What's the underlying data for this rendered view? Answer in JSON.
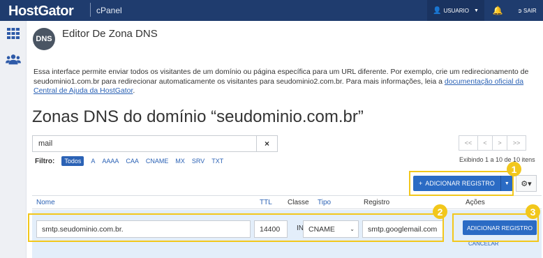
{
  "header": {
    "logo": "HostGator",
    "product": "cPanel",
    "user_label": "USUARIO",
    "logout_label": "SAIR"
  },
  "page": {
    "title": "Editor De Zona DNS",
    "icon_text": "DNS",
    "description_text": "Essa interface permite enviar todos os visitantes de um domínio ou página específica para um URL diferente. Por exemplo, crie um redirecionamento de seudominio1.com.br para redirecionar automaticamente os visitantes para seudominio2.com.br. Para mais informações, leia a ",
    "description_link": "documentação oficial da Central de Ajuda da HostGator",
    "description_end": ".",
    "zones_title": "Zonas DNS do domínio “seudominio.com.br”"
  },
  "search": {
    "value": "mail",
    "clear_icon": "×"
  },
  "filter": {
    "label": "Filtro:",
    "chips": [
      "Todos",
      "A",
      "AAAA",
      "CAA",
      "CNAME",
      "MX",
      "SRV",
      "TXT"
    ],
    "active": "Todos"
  },
  "pagination": {
    "buttons": [
      "<<",
      "<",
      ">",
      ">>"
    ],
    "info": "Exibindo 1 a 10 de 10 itens"
  },
  "actions": {
    "add_record": "ADICIONAR REGISTRO"
  },
  "table": {
    "columns": {
      "name": "Nome",
      "ttl": "TTL",
      "class": "Classe",
      "type": "Tipo",
      "record": "Registro",
      "actions": "Ações"
    },
    "edit_row": {
      "name": "smtp.seudominio.com.br.",
      "ttl": "14400",
      "class": "IN",
      "type": "CNAME",
      "record": "smtp.googlemail.com",
      "save_label": "ADICIONAR REGISTRO",
      "cancel_label": "CANCELAR"
    }
  },
  "callouts": [
    "1",
    "2",
    "3"
  ],
  "colors": {
    "topbar": "#1f3c6e",
    "primary": "#2b6bc4",
    "highlight": "#f2c71b",
    "link": "#2b62b5"
  }
}
